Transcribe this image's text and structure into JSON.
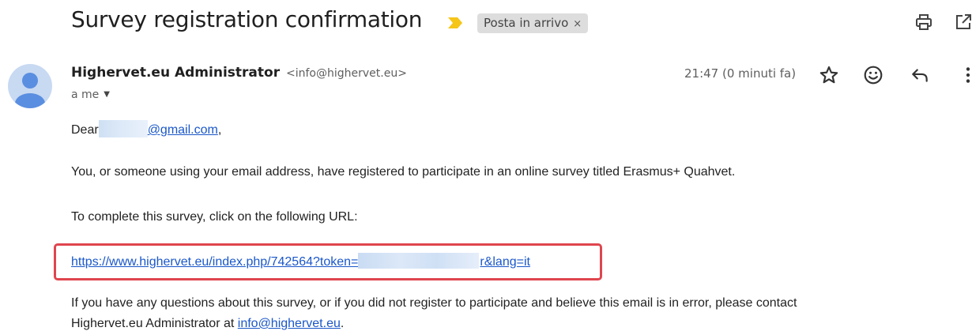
{
  "email": {
    "subject": "Survey registration confirmation",
    "label_chip": "Posta in arrivo",
    "label_chip_close": "×",
    "sender_name": "Highervet.eu Administrator",
    "sender_email": "<info@highervet.eu>",
    "to_line": "a me",
    "timestamp": "21:47 (0 minuti fa)"
  },
  "body": {
    "greeting_prefix": "Dear",
    "greeting_email_suffix": "@gmail.com",
    "greeting_comma": ",",
    "paragraph1": "You, or someone using your email address, have registered to participate in an online survey titled Erasmus+ Quahvet.",
    "paragraph2": "To complete this survey, click on the following URL:",
    "url_prefix": "https://www.highervet.eu/index.php/742564?token=",
    "url_suffix": "r&lang=it",
    "paragraph3_line1": "If you have any questions about this survey, or if you did not register to participate and believe this email is in error, please contact",
    "paragraph3_line2_prefix": "Highervet.eu Administrator at ",
    "paragraph3_link": "info@highervet.eu",
    "paragraph3_line2_suffix": "."
  },
  "icons": {
    "important": "important-marker-icon",
    "print": "print-icon",
    "popout": "open-in-new-window-icon",
    "star": "star-icon",
    "emoji": "emoji-reaction-icon",
    "reply": "reply-icon",
    "more": "more-vert-icon",
    "avatar": "avatar-icon"
  },
  "colors": {
    "important_marker": "#f5c518",
    "label_chip_bg": "#dddddd",
    "link": "#1a57c9",
    "highlight_border": "#e0454e",
    "avatar_bg": "#c8d9f2",
    "avatar_fg": "#5a8ee0"
  }
}
